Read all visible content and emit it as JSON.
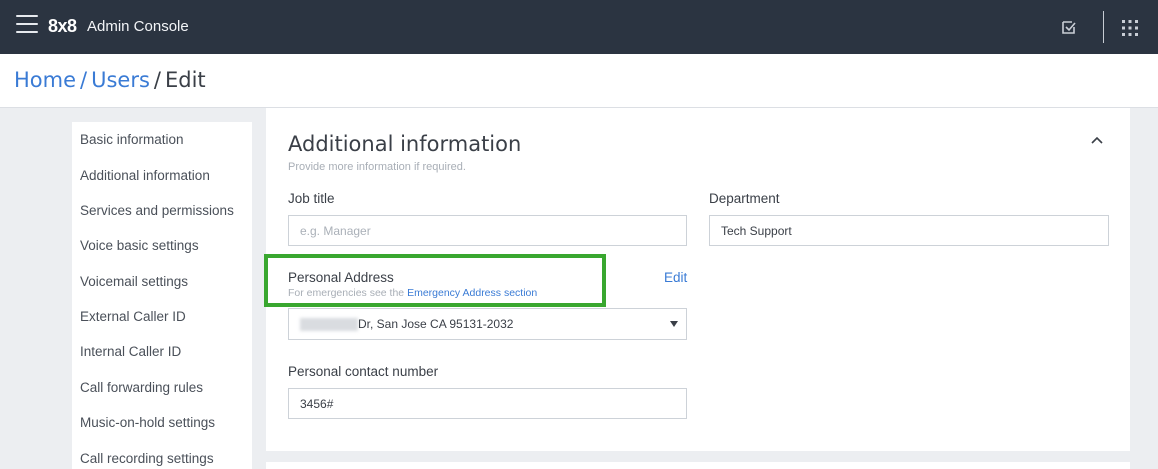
{
  "header": {
    "logo": "8x8",
    "app_title": "Admin Console"
  },
  "breadcrumb": {
    "home": "Home",
    "users": "Users",
    "current": "Edit",
    "sep": "/"
  },
  "sidebar": {
    "items": [
      {
        "label": "Basic information"
      },
      {
        "label": "Additional information"
      },
      {
        "label": "Services and permissions"
      },
      {
        "label": "Voice basic settings"
      },
      {
        "label": "Voicemail settings"
      },
      {
        "label": "External Caller ID"
      },
      {
        "label": "Internal Caller ID"
      },
      {
        "label": "Call forwarding rules"
      },
      {
        "label": "Music-on-hold settings"
      },
      {
        "label": "Call recording settings"
      }
    ]
  },
  "section": {
    "title": "Additional information",
    "subtitle": "Provide more information if required.",
    "job_title": {
      "label": "Job title",
      "value": "",
      "placeholder": "e.g. Manager"
    },
    "department": {
      "label": "Department",
      "value": "Tech Support"
    },
    "personal_address": {
      "label": "Personal Address",
      "hint_prefix": "For emergencies see the ",
      "hint_link": "Emergency Address section",
      "edit_label": "Edit",
      "value": "Dr, San Jose CA 95131-2032"
    },
    "contact_number": {
      "label": "Personal contact number",
      "value": "3456#"
    }
  },
  "colors": {
    "topbar": "#2b3441",
    "link": "#3a7bd5",
    "highlight": "#39a72f",
    "background": "#eceef1"
  },
  "icons": {
    "menu": "hamburger-menu-icon",
    "tasks": "checkbox-icon",
    "apps": "grid-apps-icon",
    "collapse": "chevron-up-icon",
    "dropdown": "caret-down-icon"
  }
}
